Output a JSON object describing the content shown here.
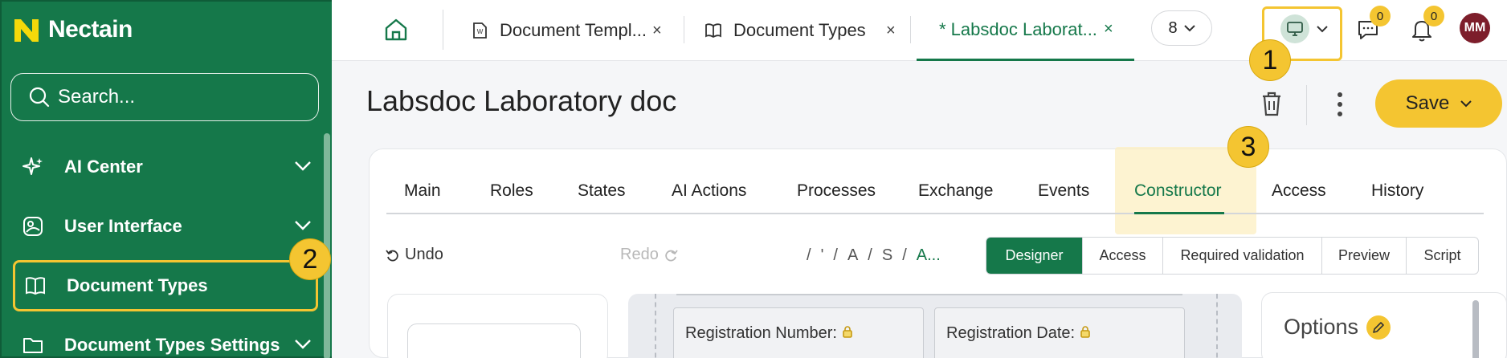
{
  "app": {
    "name": "Nectain"
  },
  "sidebar": {
    "search_placeholder": "Search...",
    "items": [
      {
        "label": "AI Center"
      },
      {
        "label": "User Interface"
      },
      {
        "label": "Document Types"
      },
      {
        "label": "Document Types Settings"
      }
    ]
  },
  "topbar": {
    "tabs": [
      {
        "label": "Document Templ...",
        "close": "×"
      },
      {
        "label": "Document Types",
        "close": "×"
      },
      {
        "label": "* Labsdoc Laborat...",
        "close": "×"
      }
    ],
    "tab_count": "8",
    "chat_badge": "0",
    "bell_badge": "0",
    "avatar_initials": "MM"
  },
  "steps": {
    "one": "1",
    "two": "2",
    "three": "3"
  },
  "page": {
    "title": "Labsdoc Laboratory doc",
    "save_label": "Save"
  },
  "content_tabs": [
    "Main",
    "Roles",
    "States",
    "AI Actions",
    "Processes",
    "Exchange",
    "Events",
    "Constructor",
    "Access",
    "History"
  ],
  "toolbar": {
    "undo": "Undo",
    "redo": "Redo",
    "breadcrumb": [
      "/",
      "'",
      "/",
      "A",
      "/",
      "S",
      "/",
      "A..."
    ],
    "modes": [
      "Designer",
      "Access",
      "Required validation",
      "Preview",
      "Script"
    ]
  },
  "fields": {
    "registration_number": "Registration Number:",
    "registration_date": "Registration Date:"
  },
  "options": {
    "title": "Options"
  },
  "colors": {
    "brand_green": "#15784a",
    "accent_yellow": "#f4c531",
    "avatar": "#7d1e2b"
  }
}
